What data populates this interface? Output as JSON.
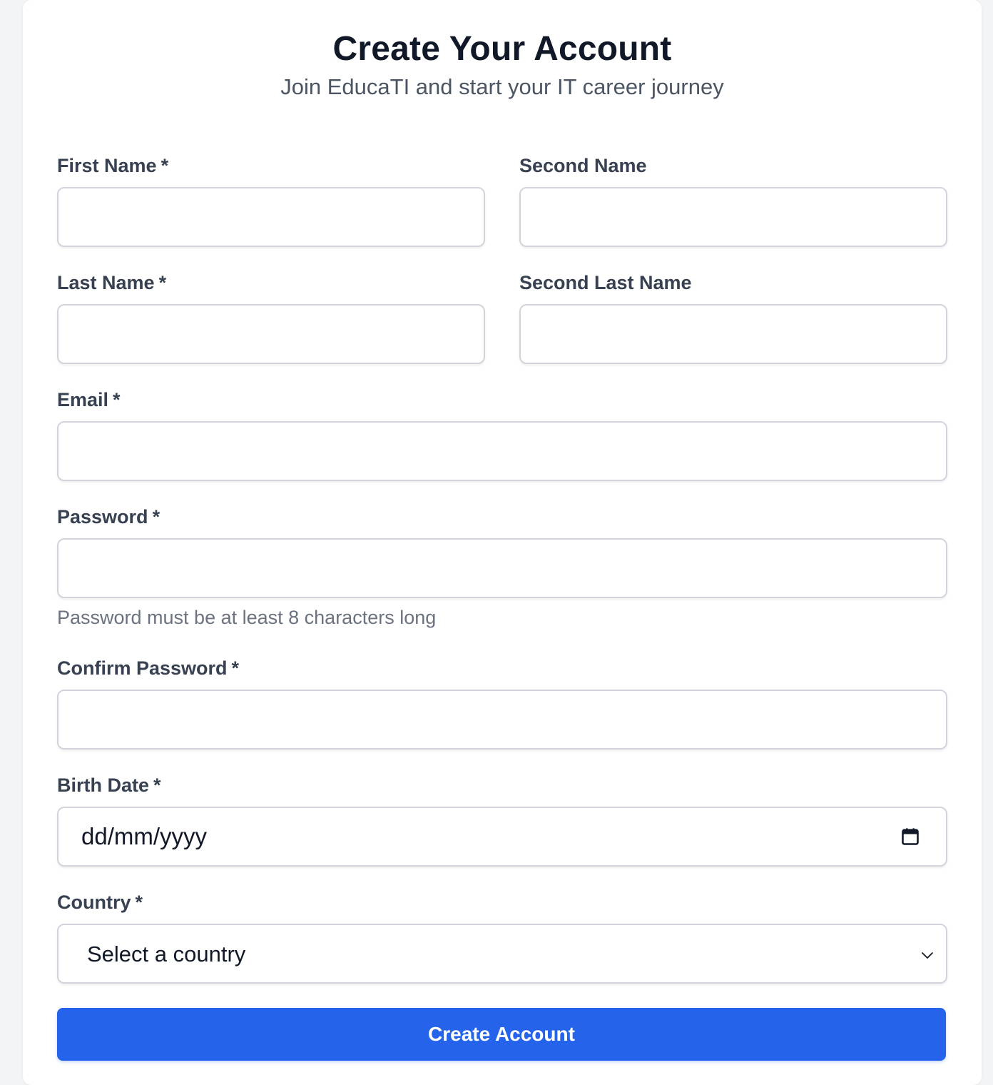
{
  "header": {
    "title": "Create Your Account",
    "subtitle": "Join EducaTI and start your IT career journey"
  },
  "form": {
    "first_name": {
      "label": "First Name",
      "required_mark": "*",
      "value": ""
    },
    "second_name": {
      "label": "Second Name",
      "value": ""
    },
    "last_name": {
      "label": "Last Name",
      "required_mark": "*",
      "value": ""
    },
    "second_last_name": {
      "label": "Second Last Name",
      "value": ""
    },
    "email": {
      "label": "Email",
      "required_mark": "*",
      "value": ""
    },
    "password": {
      "label": "Password",
      "required_mark": "*",
      "value": "",
      "hint": "Password must be at least 8 characters long"
    },
    "confirm_password": {
      "label": "Confirm Password",
      "required_mark": "*",
      "value": ""
    },
    "birth_date": {
      "label": "Birth Date",
      "required_mark": "*",
      "placeholder": "dd/mm/yyyy",
      "icon": "calendar-icon"
    },
    "country": {
      "label": "Country",
      "required_mark": "*",
      "selected": "Select a country",
      "icon": "chevron-down-icon"
    },
    "submit_label": "Create Account"
  },
  "colors": {
    "page_background": "#f3f4f6",
    "card_background": "#ffffff",
    "title": "#111827",
    "subtitle": "#4b5563",
    "label": "#374151",
    "hint": "#6b7280",
    "input_border": "#d1d5db",
    "primary_button": "#2563eb"
  }
}
